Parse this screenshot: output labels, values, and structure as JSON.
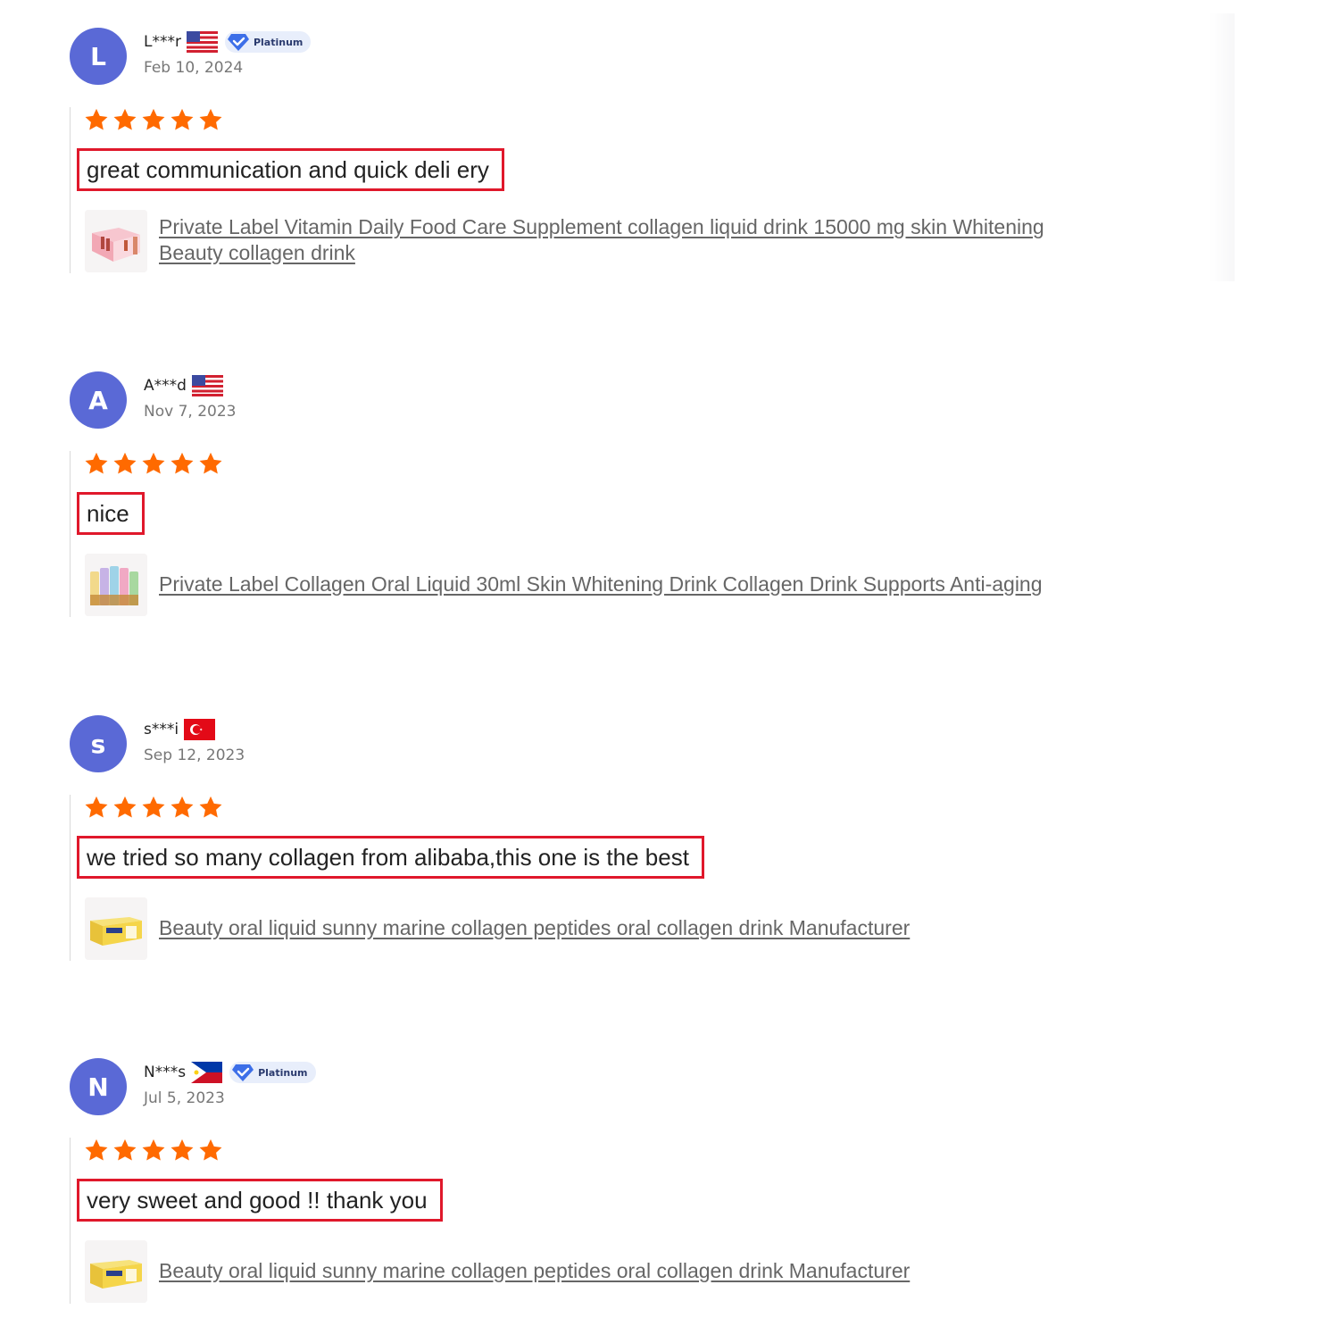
{
  "colors": {
    "avatar": "#5a69d6",
    "star": "#ff6a00",
    "highlight_border": "#e0182b",
    "date_text": "#777777",
    "link_text": "#666666"
  },
  "reviews": [
    {
      "initial": "L",
      "name": "L***r",
      "flag": "us-flag-icon",
      "badge": "Platinum",
      "date": "Feb 10, 2024",
      "rating": 5,
      "comment": "great communication and quick deli ery",
      "product": "Private Label Vitamin Daily Food Care Supplement collagen liquid drink 15000 mg skin Whitening Beauty collagen drink",
      "thumb": "pink-box-vials-thumbnail"
    },
    {
      "initial": "A",
      "name": "A***d",
      "flag": "us-flag-icon",
      "badge": null,
      "date": "Nov 7, 2023",
      "rating": 5,
      "comment": "nice",
      "product": "Private Label Collagen Oral Liquid 30ml Skin Whitening Drink Collagen Drink Supports Anti-aging",
      "thumb": "colored-bottles-thumbnail"
    },
    {
      "initial": "s",
      "name": "s***i",
      "flag": "turkey-flag-icon",
      "badge": null,
      "date": "Sep 12, 2023",
      "rating": 5,
      "comment": "we tried so many collagen from alibaba,this one is the best",
      "product": "Beauty oral liquid sunny marine collagen peptides oral collagen drink Manufacturer",
      "thumb": "yellow-box-thumbnail"
    },
    {
      "initial": "N",
      "name": "N***s",
      "flag": "philippines-flag-icon",
      "badge": "Platinum",
      "date": "Jul 5, 2023",
      "rating": 5,
      "comment": "very sweet and good !! thank you",
      "product": "Beauty oral liquid sunny marine collagen peptides oral collagen drink Manufacturer",
      "thumb": "yellow-box-thumbnail"
    }
  ]
}
